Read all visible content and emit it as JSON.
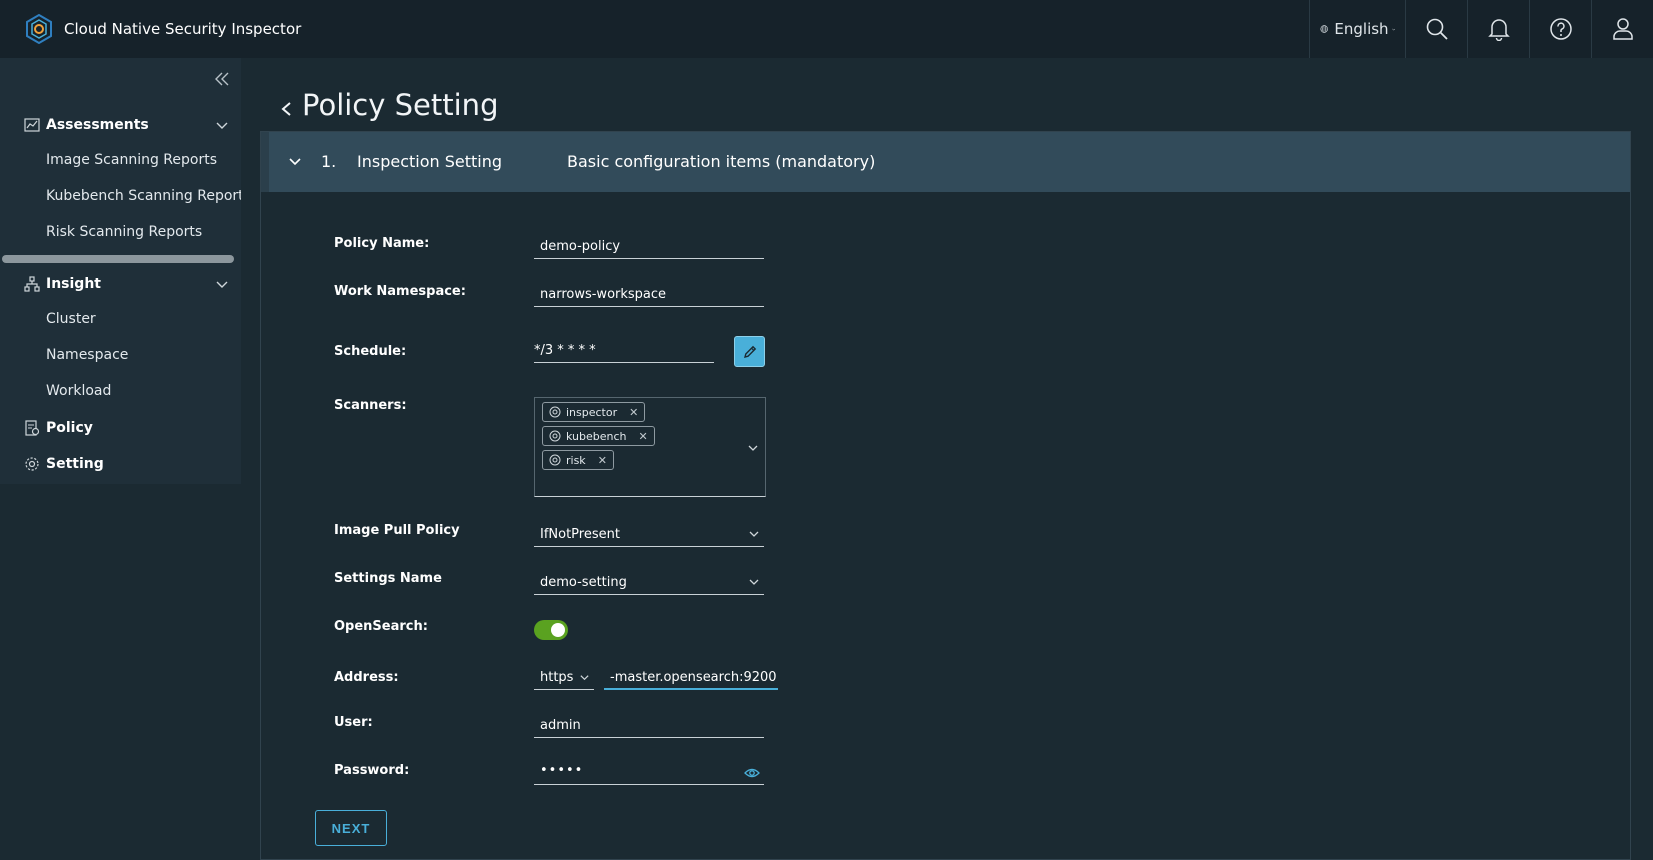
{
  "app": {
    "title": "Cloud Native Security Inspector",
    "language": "English"
  },
  "header_icons": [
    "globe-icon",
    "search-icon",
    "bell-icon",
    "help-icon",
    "user-icon"
  ],
  "sidebar": {
    "groups": [
      {
        "label": "Assessments",
        "icon": "chart-icon",
        "items": [
          "Image Scanning Reports",
          "Kubebench Scanning Reports",
          "Risk Scanning Reports"
        ]
      },
      {
        "label": "Insight",
        "icon": "hierarchy-icon",
        "items": [
          "Cluster",
          "Namespace",
          "Workload"
        ]
      },
      {
        "label": "Policy",
        "icon": "policy-icon",
        "items": []
      },
      {
        "label": "Setting",
        "icon": "gear-icon",
        "items": []
      }
    ]
  },
  "page": {
    "title": "Policy Setting"
  },
  "step": {
    "number": "1.",
    "title": "Inspection Setting",
    "description": "Basic configuration items (mandatory)"
  },
  "form": {
    "policy_name": {
      "label": "Policy Name:",
      "value": "demo-policy"
    },
    "work_namespace": {
      "label": "Work Namespace:",
      "value": "narrows-workspace"
    },
    "schedule": {
      "label": "Schedule:",
      "value": "*/3 * * * *"
    },
    "scanners": {
      "label": "Scanners:",
      "selected": [
        "inspector",
        "kubebench",
        "risk"
      ]
    },
    "image_pull_policy": {
      "label": "Image Pull Policy",
      "value": "IfNotPresent"
    },
    "settings_name": {
      "label": "Settings Name",
      "value": "demo-setting"
    },
    "opensearch": {
      "label": "OpenSearch:",
      "enabled": true
    },
    "address": {
      "label": "Address:",
      "protocol": "https",
      "value": "-master.opensearch:9200"
    },
    "user": {
      "label": "User:",
      "value": "admin"
    },
    "password": {
      "label": "Password:",
      "value": "•••••"
    }
  },
  "actions": {
    "next_label": "NEXT"
  },
  "colors": {
    "header_bg": "#16222a",
    "body_bg": "#1b2a32",
    "panel_head_bg": "#324b5a",
    "accent": "#49afd9",
    "toggle_on": "#5aa220"
  }
}
